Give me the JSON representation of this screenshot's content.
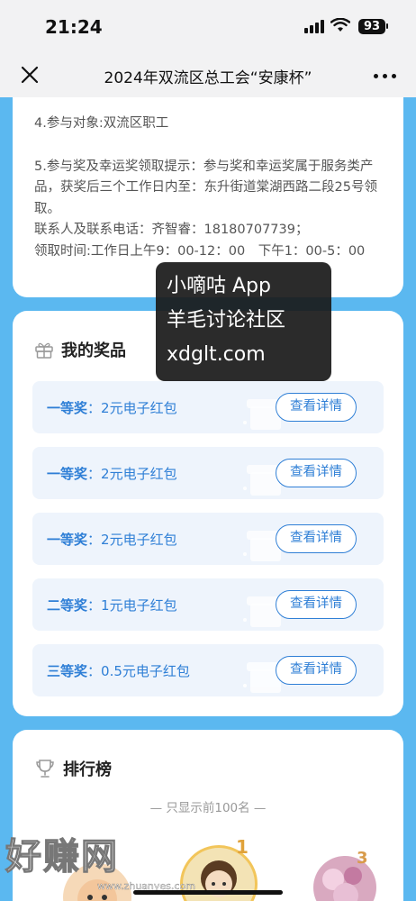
{
  "status_bar": {
    "time": "21:24",
    "battery": "93"
  },
  "nav": {
    "title": "2024年双流区总工会“安康杯”"
  },
  "rules": {
    "line1": "4.参与对象:双流区职工",
    "line2": "5.参与奖及幸运奖领取提示：参与奖和幸运奖属于服务类产品，获奖后三个工作日内至：东升街道棠湖西路二段25号领取。",
    "line3": "联系人及联系电话：齐智睿：18180707739；",
    "line4": "领取时间:工作日上午9：00-12：00　下午1：00-5：00"
  },
  "prizes": {
    "title": "我的奖品",
    "items": [
      {
        "level": "一等奖",
        "sep": "：",
        "desc": "2元电子红包",
        "button": "查看详情"
      },
      {
        "level": "一等奖",
        "sep": "：",
        "desc": "2元电子红包",
        "button": "查看详情"
      },
      {
        "level": "一等奖",
        "sep": "：",
        "desc": "2元电子红包",
        "button": "查看详情"
      },
      {
        "level": "二等奖",
        "sep": "：",
        "desc": "1元电子红包",
        "button": "查看详情"
      },
      {
        "level": "三等奖",
        "sep": "：",
        "desc": "0.5元电子红包",
        "button": "查看详情"
      }
    ]
  },
  "ranking": {
    "title": "排行榜",
    "note": "— 只显示前100名 —",
    "badges": [
      "1",
      "3"
    ]
  },
  "watermark": {
    "line1": "小嘀咕 App",
    "line2": "羊毛讨论社区",
    "line3": "xdglt.com"
  },
  "bottom_watermark": {
    "brand": "好赚网",
    "url": "www.zhuanyes.com"
  },
  "colors": {
    "accent": "#2f7fd6",
    "background": "#5bb8f0",
    "row_bg": "#eef4fc"
  }
}
